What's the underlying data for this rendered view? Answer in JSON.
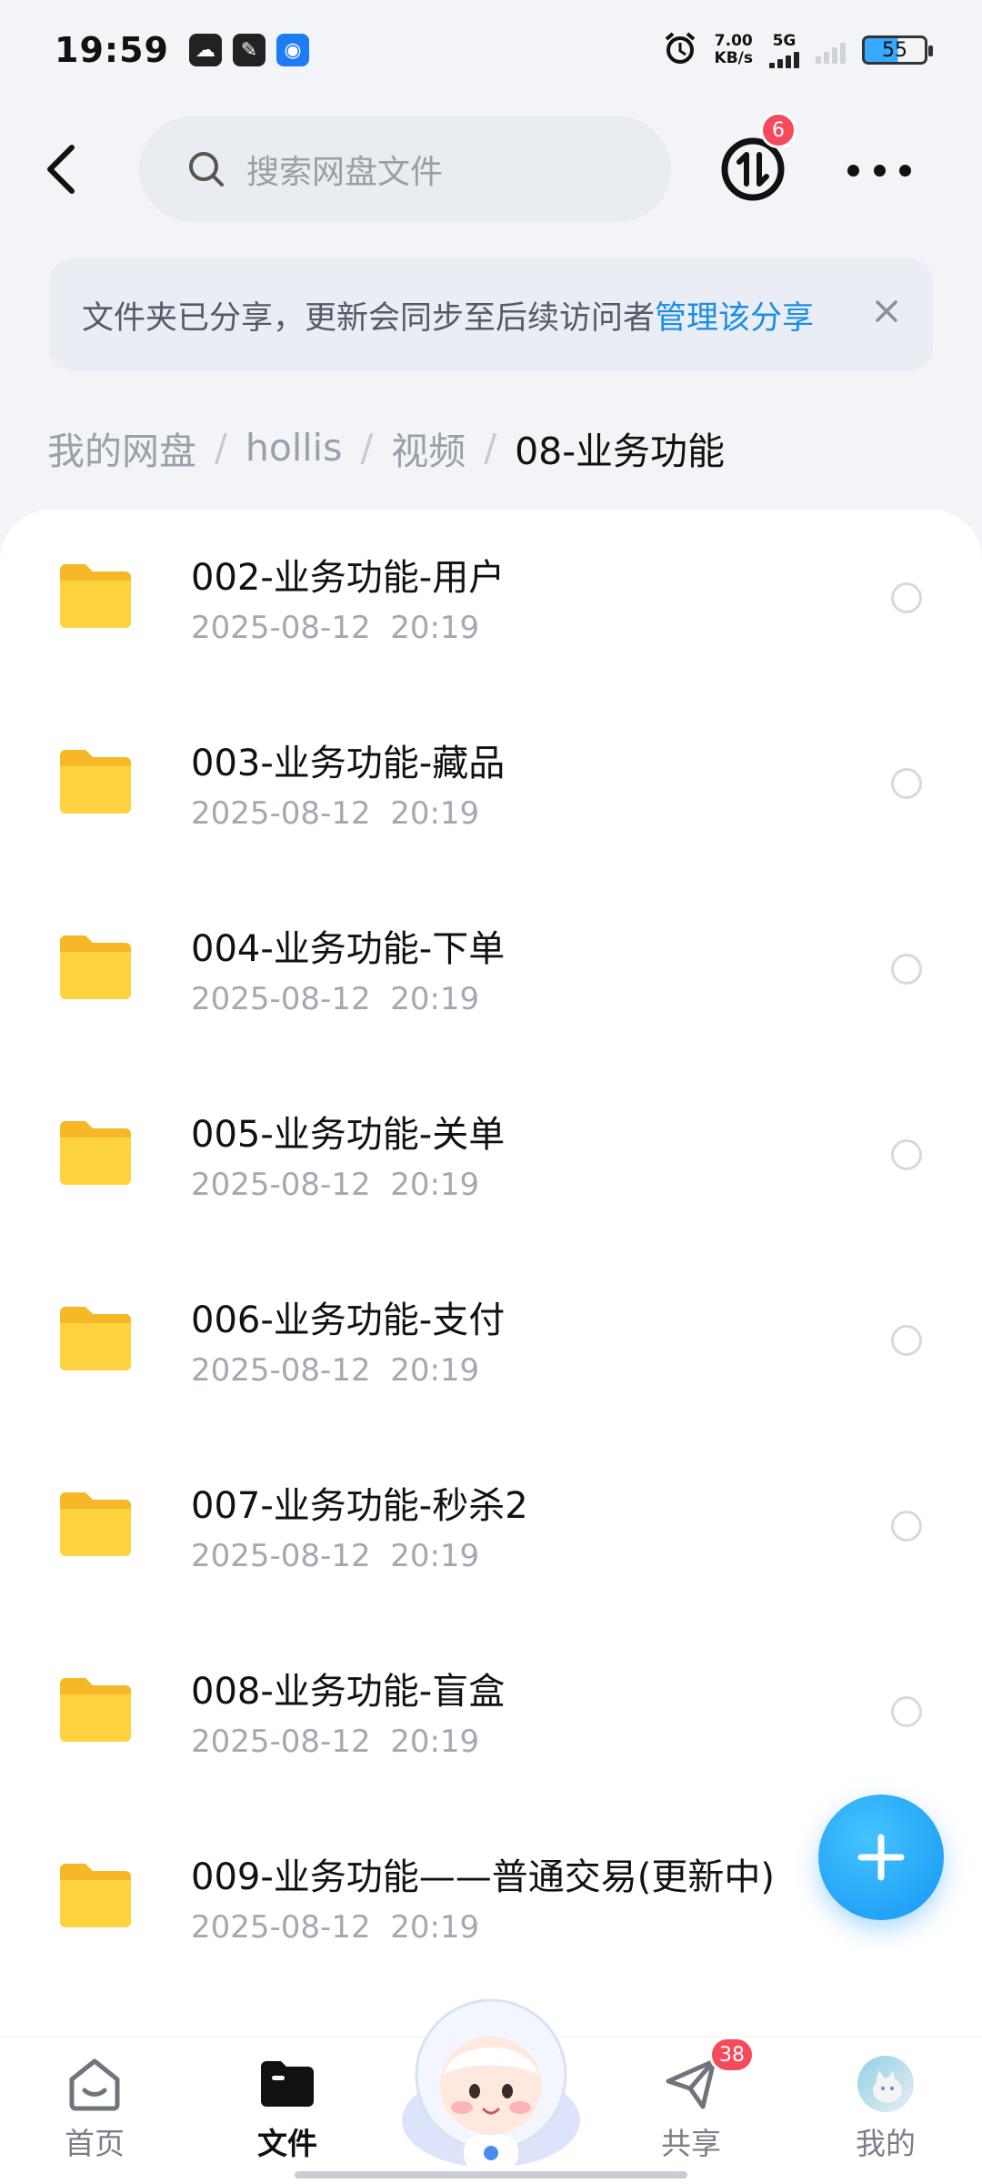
{
  "status_bar": {
    "time": "19:59",
    "net_speed_value": "7.00",
    "net_speed_unit": "KB/s",
    "network": "5G",
    "battery": "55"
  },
  "header": {
    "search_placeholder": "搜索网盘文件",
    "transfer_badge": "6"
  },
  "notice": {
    "message": "文件夹已分享，更新会同步至后续访问者",
    "link": "管理该分享"
  },
  "breadcrumb": [
    "我的网盘",
    "hollis",
    "视频",
    "08-业务功能"
  ],
  "files": [
    {
      "name": "002-业务功能-用户",
      "date": "2025-08-12  20:19"
    },
    {
      "name": "003-业务功能-藏品",
      "date": "2025-08-12  20:19"
    },
    {
      "name": "004-业务功能-下单",
      "date": "2025-08-12  20:19"
    },
    {
      "name": "005-业务功能-关单",
      "date": "2025-08-12  20:19"
    },
    {
      "name": "006-业务功能-支付",
      "date": "2025-08-12  20:19"
    },
    {
      "name": "007-业务功能-秒杀2",
      "date": "2025-08-12  20:19"
    },
    {
      "name": "008-业务功能-盲盒",
      "date": "2025-08-12  20:19"
    },
    {
      "name": "009-业务功能——普通交易(更新中)",
      "date": "2025-08-12  20:19"
    }
  ],
  "nav": {
    "home": "首页",
    "files": "文件",
    "share": "共享",
    "mine": "我的",
    "share_badge": "38"
  },
  "colors": {
    "accent": "#1a8fe6",
    "badge": "#f44a5c",
    "folder": "#ffcf3f"
  }
}
